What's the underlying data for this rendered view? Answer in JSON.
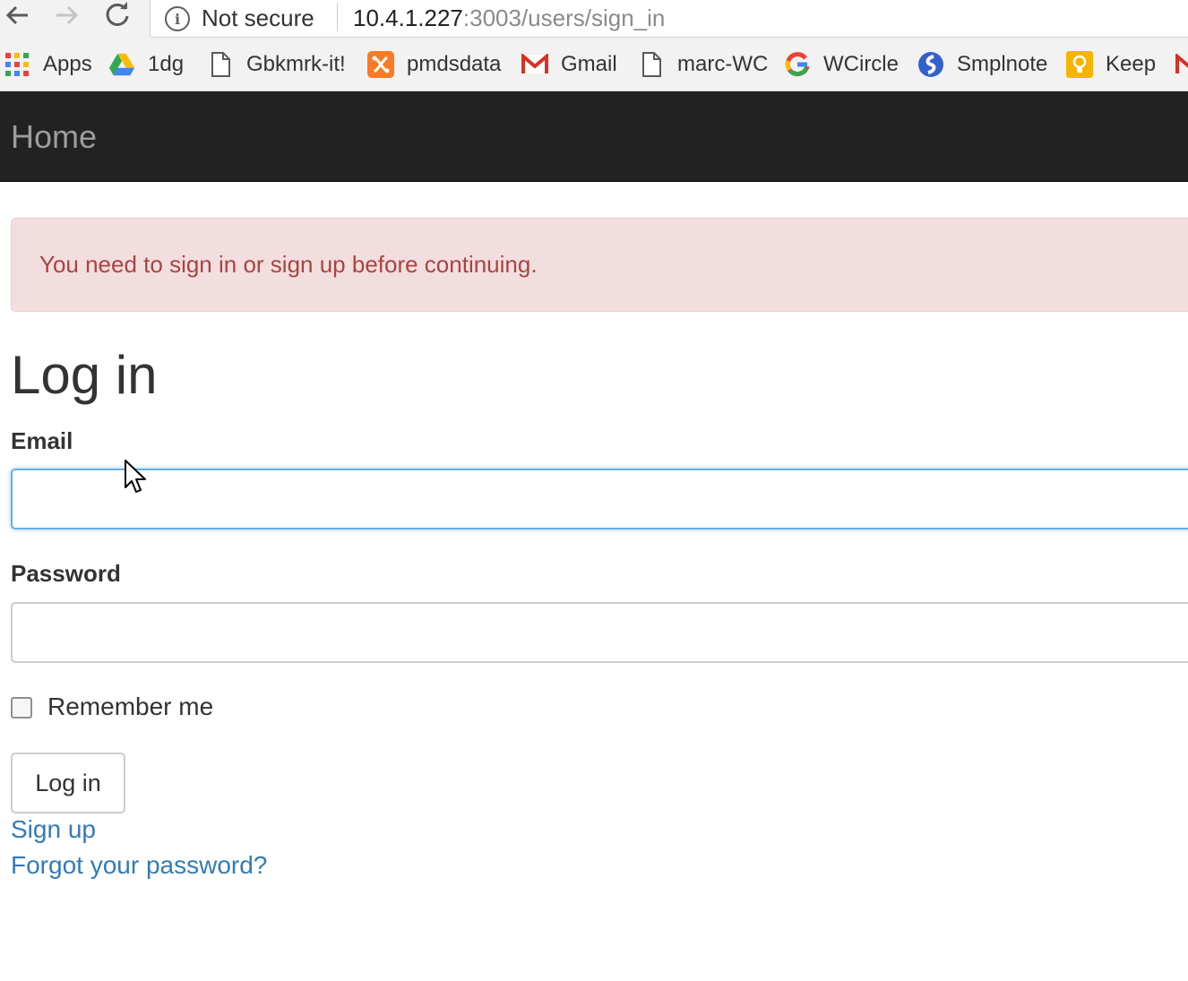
{
  "browser": {
    "security_label": "Not secure",
    "url_host": "10.4.1.227",
    "url_path": ":3003/users/sign_in",
    "nav_icons": [
      "back-arrow-icon",
      "forward-arrow-icon",
      "reload-icon",
      "info-icon"
    ],
    "bookmarks": [
      {
        "label": "Apps",
        "icon": "apps-grid-icon"
      },
      {
        "label": "1dg",
        "icon": "google-drive-icon"
      },
      {
        "label": "Gbkmrk-it!",
        "icon": "page-icon"
      },
      {
        "label": "pmdsdata",
        "icon": "xampp-icon"
      },
      {
        "label": "Gmail",
        "icon": "gmail-icon"
      },
      {
        "label": "marc-WC",
        "icon": "page-icon"
      },
      {
        "label": "WCircle",
        "icon": "google-g-icon"
      },
      {
        "label": "Smplnote",
        "icon": "simplenote-icon"
      },
      {
        "label": "Keep",
        "icon": "keep-bulb-icon"
      }
    ]
  },
  "navbar": {
    "brand": "Home",
    "background_color": "#222222",
    "brand_color": "#9d9d9d"
  },
  "alert": {
    "message": "You need to sign in or sign up before continuing.",
    "text_color": "#a94442",
    "background_color": "#f2dede"
  },
  "form": {
    "title": "Log in",
    "email_label": "Email",
    "email_value": "",
    "password_label": "Password",
    "password_value": "",
    "remember_label": "Remember me",
    "remember_checked": false,
    "submit_label": "Log in",
    "focus_color": "#66afe9"
  },
  "links": {
    "sign_up": "Sign up",
    "forgot_password": "Forgot your password?",
    "color": "#337ab7"
  }
}
